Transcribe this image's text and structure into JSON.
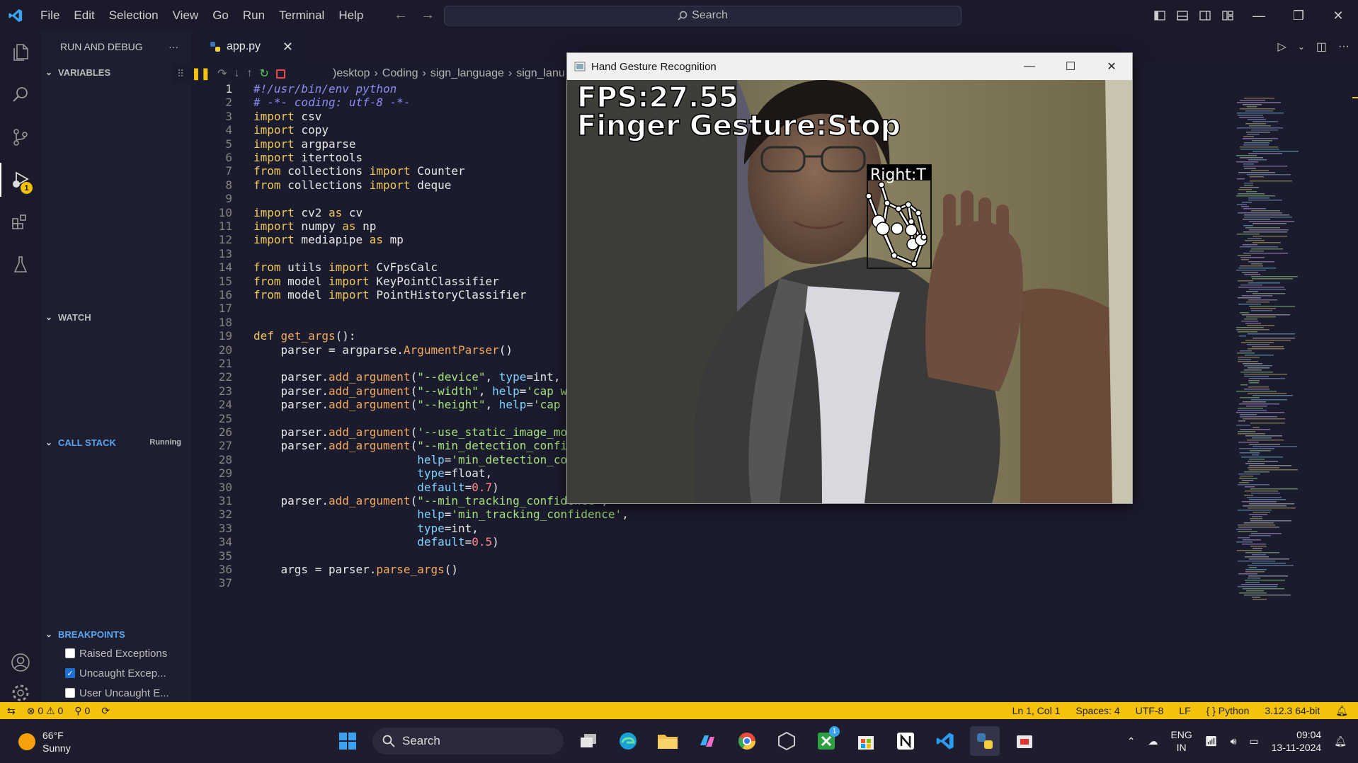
{
  "menu": [
    "File",
    "Edit",
    "Selection",
    "View",
    "Go",
    "Run",
    "Terminal",
    "Help"
  ],
  "search": {
    "label": "Search"
  },
  "sidebar": {
    "title": "RUN AND DEBUG",
    "sections": {
      "variables": "VARIABLES",
      "watch": "WATCH",
      "callstack": "CALL STACK",
      "callstack_status": "Running",
      "breakpoints": "BREAKPOINTS"
    },
    "breakpoints": [
      {
        "label": "Raised Exceptions",
        "checked": false
      },
      {
        "label": "Uncaught Excep...",
        "checked": true
      },
      {
        "label": "User Uncaught E...",
        "checked": false
      }
    ]
  },
  "activity_badge": "1",
  "tab": {
    "name": "app.py"
  },
  "breadcrumbs": [
    ")esktop",
    "Coding",
    "sign_language",
    "sign_lanu"
  ],
  "code_lines": [
    "#!/usr/bin/env python",
    "# -*- coding: utf-8 -*-",
    "import csv",
    "import copy",
    "import argparse",
    "import itertools",
    "from collections import Counter",
    "from collections import deque",
    "",
    "import cv2 as cv",
    "import numpy as np",
    "import mediapipe as mp",
    "",
    "from utils import CvFpsCalc",
    "from model import KeyPointClassifier",
    "from model import PointHistoryClassifier",
    "",
    "",
    "def get_args():",
    "    parser = argparse.ArgumentParser()",
    "",
    "    parser.add_argument(\"--device\", type=int,",
    "    parser.add_argument(\"--width\", help='cap w",
    "    parser.add_argument(\"--height\", help='cap",
    "",
    "    parser.add_argument('--use_static_image_mode', action='store_true')",
    "    parser.add_argument(\"--min_detection_confidence\",",
    "                        help='min_detection_confidence',",
    "                        type=float,",
    "                        default=0.7)",
    "    parser.add_argument(\"--min_tracking_confidence\",",
    "                        help='min_tracking_confidence',",
    "                        type=int,",
    "                        default=0.5)",
    "",
    "    args = parser.parse_args()",
    ""
  ],
  "statusbar": {
    "errors": "0",
    "warnings": "0",
    "ports": "0",
    "position": "Ln 1, Col 1",
    "spaces": "Spaces: 4",
    "encoding": "UTF-8",
    "eol": "LF",
    "language": "Python",
    "interpreter": "3.12.3 64-bit"
  },
  "camera_window": {
    "title": "Hand Gesture Recognition",
    "fps": "FPS:27.55",
    "gesture": "Finger Gesture:Stop",
    "hand_label": "Right:T"
  },
  "taskbar": {
    "temp": "66°F",
    "weather": "Sunny",
    "search": "Search",
    "lang1": "ENG",
    "lang2": "IN",
    "time": "09:04",
    "date": "13-11-2024",
    "xbox_badge": "1"
  },
  "colors": {
    "statusbar": "#f4c20d",
    "activity_bg": "#1a1a2b",
    "editor_bg": "#1b1b2e"
  }
}
